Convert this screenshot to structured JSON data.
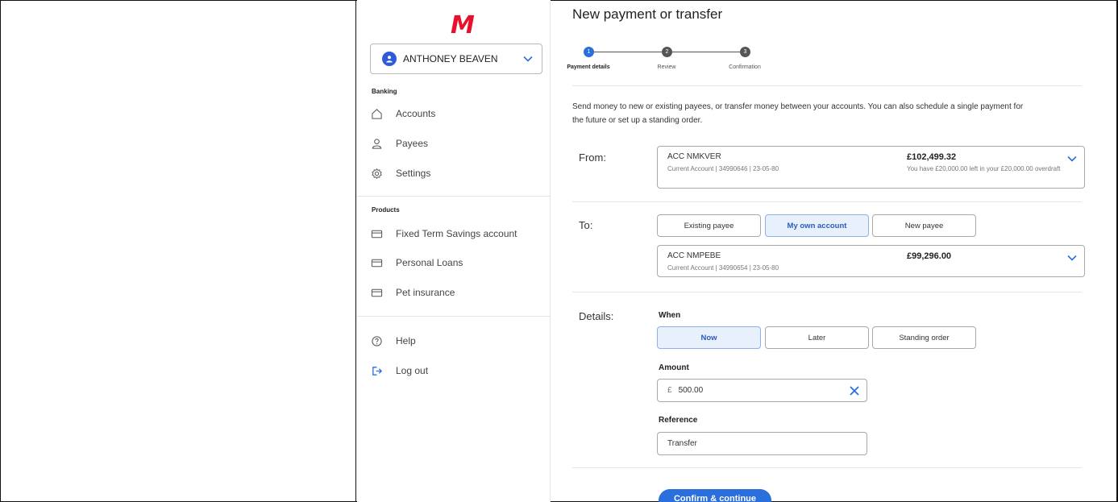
{
  "sidebar": {
    "logo": "M",
    "user_name": "ANTHONEY BEAVEN",
    "banking_title": "Banking",
    "banking_items": [
      {
        "label": "Accounts",
        "icon": "home-icon"
      },
      {
        "label": "Payees",
        "icon": "person-icon"
      },
      {
        "label": "Settings",
        "icon": "gear-icon"
      }
    ],
    "products_title": "Products",
    "product_items": [
      {
        "label": "Fixed Term Savings account",
        "icon": "card-icon"
      },
      {
        "label": "Personal Loans",
        "icon": "card-icon"
      },
      {
        "label": "Pet insurance",
        "icon": "card-icon"
      }
    ],
    "help_label": "Help",
    "logout_label": "Log out"
  },
  "main": {
    "title": "New payment or transfer",
    "steps": [
      {
        "number": "1",
        "label": "Payment details",
        "active": true
      },
      {
        "number": "2",
        "label": "Review",
        "active": false
      },
      {
        "number": "3",
        "label": "Confirmation",
        "active": false
      }
    ],
    "intro": "Send money to new or existing payees, or transfer money between your accounts. You can also schedule a single payment for the future or set up a standing order.",
    "from": {
      "label": "From:",
      "account_name": "ACC NMKVER",
      "account_sub": "Current Account | 34990646 | 23-05-80",
      "balance": "£102,499.32",
      "note": "You have £20,000.00 left in your £20,000.00 overdraft"
    },
    "to": {
      "label": "To:",
      "options": [
        "Existing payee",
        "My own account",
        "New payee"
      ],
      "selected": "My own account",
      "account_name": "ACC NMPEBE",
      "account_sub": "Current Account | 34990654 | 23-05-80",
      "balance": "£99,296.00"
    },
    "details": {
      "label": "Details:",
      "when_label": "When",
      "when_options": [
        "Now",
        "Later",
        "Standing order"
      ],
      "when_selected": "Now",
      "amount_label": "Amount",
      "currency": "£",
      "amount_value": "500.00",
      "reference_label": "Reference",
      "reference_value": "Transfer"
    },
    "confirm_label": "Confirm & continue"
  },
  "colors": {
    "accent": "#2a6fdb",
    "logo": "#e8112d",
    "selected_bg": "#e8f0fc"
  }
}
